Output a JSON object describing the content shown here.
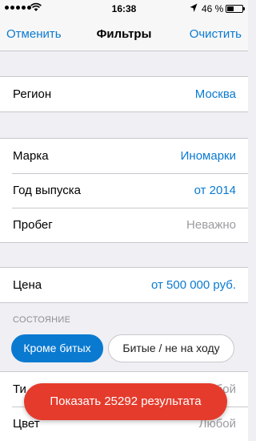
{
  "status_bar": {
    "time": "16:38",
    "battery_text": "46 %"
  },
  "nav": {
    "left_label": "Отменить",
    "title": "Фильтры",
    "right_label": "Очистить"
  },
  "region_group": [
    {
      "label": "Регион",
      "value": "Москва"
    }
  ],
  "car_group": [
    {
      "label": "Марка",
      "value": "Иномарки"
    },
    {
      "label": "Год выпуска",
      "value": "от 2014"
    },
    {
      "label": "Пробег",
      "value": "Неважно"
    }
  ],
  "price_group": [
    {
      "label": "Цена",
      "value": "от 500 000 руб."
    }
  ],
  "condition": {
    "header": "СОСТОЯНИЕ",
    "chips": [
      {
        "label": "Кроме битых"
      },
      {
        "label": "Битые / не на ходу"
      }
    ]
  },
  "bottom_group": [
    {
      "label": "Ти",
      "value": "бой"
    },
    {
      "label": "Цвет",
      "value": "Любой"
    }
  ],
  "show_results_label": "Показать 25292 результата"
}
